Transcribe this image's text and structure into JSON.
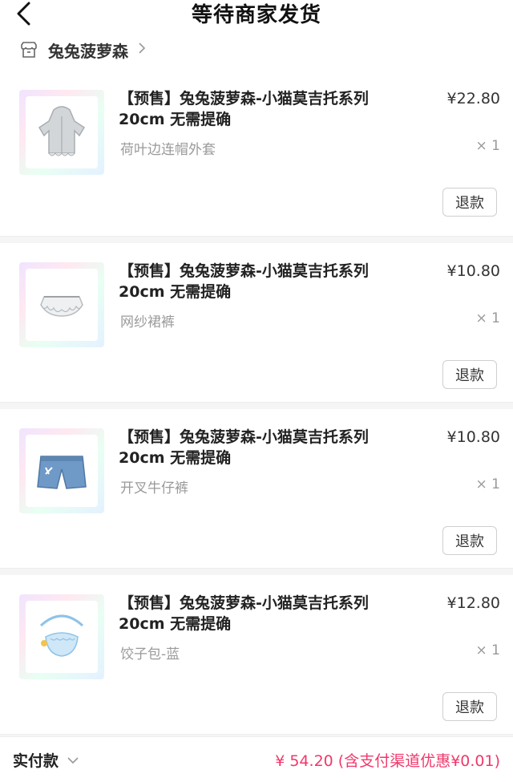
{
  "header": {
    "title": "等待商家发货"
  },
  "shop": {
    "name": "兔兔菠萝森"
  },
  "items": [
    {
      "name": "【预售】兔兔菠萝森-小猫莫吉托系列20cm 无需提确",
      "spec": "荷叶边连帽外套",
      "price": "¥22.80",
      "qty": "× 1",
      "refund": "退款",
      "icon": "hooded-jacket-icon"
    },
    {
      "name": "【预售】兔兔菠萝森-小猫莫吉托系列20cm 无需提确",
      "spec": "网纱裙裤",
      "price": "¥10.80",
      "qty": "× 1",
      "refund": "退款",
      "icon": "tutu-skirt-icon"
    },
    {
      "name": "【预售】兔兔菠萝森-小猫莫吉托系列20cm 无需提确",
      "spec": "开叉牛仔裤",
      "price": "¥10.80",
      "qty": "× 1",
      "refund": "退款",
      "icon": "denim-shorts-icon"
    },
    {
      "name": "【预售】兔兔菠萝森-小猫莫吉托系列20cm 无需提确",
      "spec": "饺子包-蓝",
      "price": "¥12.80",
      "qty": "× 1",
      "refund": "退款",
      "icon": "dumpling-bag-icon"
    }
  ],
  "footer": {
    "label": "实付款",
    "amount": "¥ 54.20 (含支付渠道优惠¥0.01)"
  },
  "colors": {
    "accent": "#f0386b"
  }
}
